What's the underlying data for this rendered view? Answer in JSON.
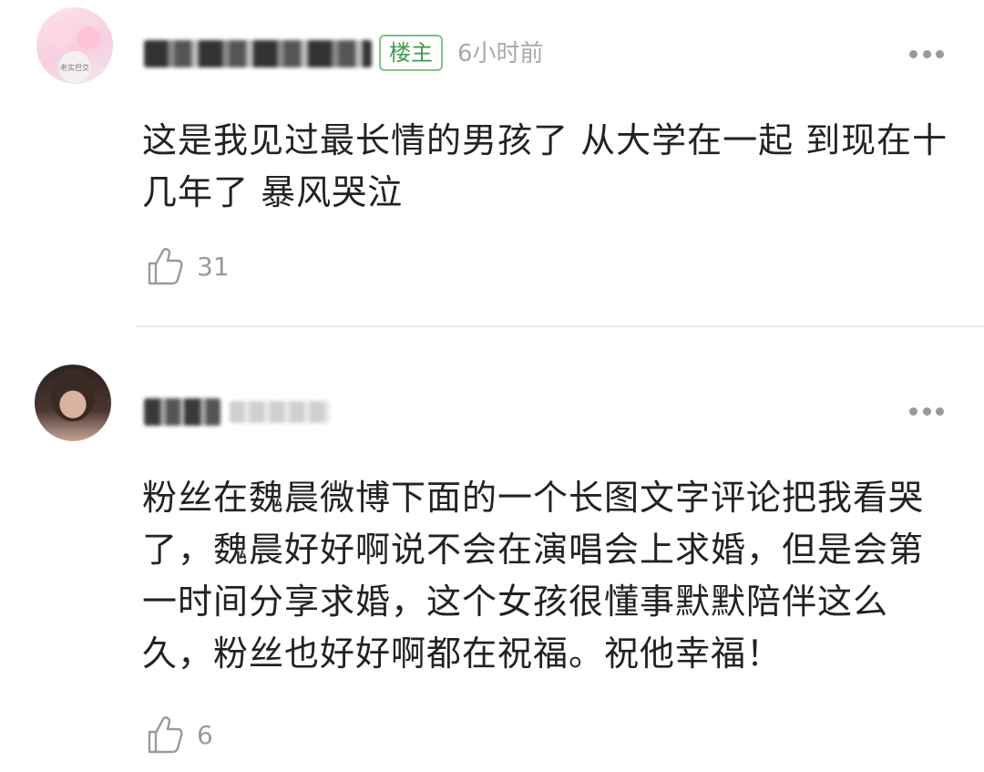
{
  "comments": [
    {
      "badge": "楼主",
      "time": "6小时前",
      "avatar_caption": "老实巴交",
      "text": "这是我见过最长情的男孩了 从大学在一起 到现在十几年了 暴风哭泣",
      "likes": "31"
    },
    {
      "text": "粉丝在魏晨微博下面的一个长图文字评论把我看哭了，魏晨好好啊说不会在演唱会上求婚，但是会第一时间分享求婚，这个女孩很懂事默默陪伴这么久，粉丝也好好啊都在祝福。祝他幸福！",
      "likes": "6"
    }
  ],
  "icons": {
    "more": "more-dots-icon",
    "like": "thumbs-up-icon"
  },
  "colors": {
    "badge_green": "#3f9a4e",
    "text": "#222222",
    "muted": "#a9a9a9"
  }
}
